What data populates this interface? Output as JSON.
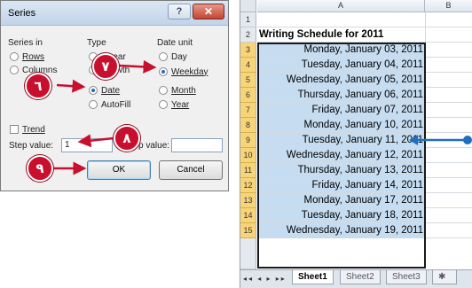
{
  "dialog": {
    "title": "Series",
    "help_glyph": "?",
    "close_glyph": "✕",
    "series_in": {
      "label": "Series in",
      "options": [
        "Rows",
        "Columns"
      ]
    },
    "type": {
      "label": "Type",
      "options": [
        "Linear",
        "Growth",
        "Date",
        "AutoFill"
      ],
      "selected": "Date"
    },
    "date_unit": {
      "label": "Date unit",
      "options": [
        "Day",
        "Weekday",
        "Month",
        "Year"
      ],
      "selected": "Weekday"
    },
    "trend_label": "Trend",
    "step_value_label": "Step value:",
    "step_value": "1",
    "stop_value_label": "Stop value:",
    "stop_value": "",
    "ok_label": "OK",
    "cancel_label": "Cancel"
  },
  "callouts": {
    "step6": "٦",
    "step7": "٧",
    "step8": "٨",
    "step9": "٩",
    "color": "#c8102e"
  },
  "sheet": {
    "columns": [
      "A",
      "B"
    ],
    "rows": [
      {
        "num": "1",
        "value": ""
      },
      {
        "num": "2",
        "value": "Writing Schedule for 2011"
      },
      {
        "num": "3",
        "value": "Monday, January 03, 2011"
      },
      {
        "num": "4",
        "value": "Tuesday, January 04, 2011"
      },
      {
        "num": "5",
        "value": "Wednesday, January 05, 2011"
      },
      {
        "num": "6",
        "value": "Thursday, January 06, 2011"
      },
      {
        "num": "7",
        "value": "Friday, January 07, 2011"
      },
      {
        "num": "8",
        "value": "Monday, January 10, 2011"
      },
      {
        "num": "9",
        "value": "Tuesday, January 11, 2011"
      },
      {
        "num": "10",
        "value": "Wednesday, January 12, 2011"
      },
      {
        "num": "11",
        "value": "Thursday, January 13, 2011"
      },
      {
        "num": "12",
        "value": "Friday, January 14, 2011"
      },
      {
        "num": "13",
        "value": "Monday, January 17, 2011"
      },
      {
        "num": "14",
        "value": "Tuesday, January 18, 2011"
      },
      {
        "num": "15",
        "value": "Wednesday, January 19, 2011"
      }
    ],
    "tabs": [
      "Sheet1",
      "Sheet2",
      "Sheet3"
    ],
    "active_tab": "Sheet1",
    "nav_glyphs": "◂◂ ◂ ▸ ▸▸",
    "selection_color": "#c6ddf1",
    "arrow_color": "#1f6fc0"
  }
}
